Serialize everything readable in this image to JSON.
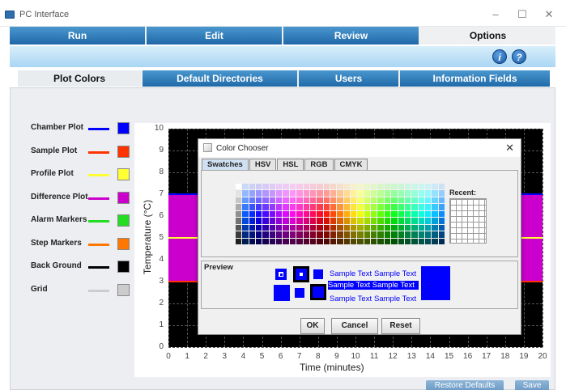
{
  "window": {
    "title": "PC Interface",
    "minimize": "–",
    "maximize": "☐",
    "close": "✕"
  },
  "main_tabs": [
    "Run",
    "Edit",
    "Review",
    "Options"
  ],
  "sub_tabs": [
    "Plot Colors",
    "Default Directories",
    "Users",
    "Information Fields"
  ],
  "legend": [
    {
      "label": "Chamber Plot",
      "color": "#0000ff"
    },
    {
      "label": "Sample Plot",
      "color": "#ff3300"
    },
    {
      "label": "Profile Plot",
      "color": "#ffff33"
    },
    {
      "label": "Difference Plot",
      "color": "#cc00cc"
    },
    {
      "label": "Alarm Markers",
      "color": "#22dd22"
    },
    {
      "label": "Step Markers",
      "color": "#ff7700"
    },
    {
      "label": "Back Ground",
      "color": "#000000"
    },
    {
      "label": "Grid",
      "color": "#cccccc"
    }
  ],
  "chart_data": {
    "type": "line",
    "xlabel": "Time (minutes)",
    "ylabel": "Temperature (°C)",
    "xlim": [
      0,
      20
    ],
    "ylim": [
      0,
      10
    ],
    "x_ticks": [
      "0",
      "1",
      "2",
      "3",
      "4",
      "5",
      "6",
      "7",
      "8",
      "9",
      "10",
      "11",
      "12",
      "13",
      "14",
      "15",
      "16",
      "17",
      "18",
      "19",
      "20"
    ],
    "y_ticks": [
      "0",
      "1",
      "2",
      "3",
      "4",
      "5",
      "6",
      "7",
      "8",
      "9",
      "10"
    ],
    "series": [
      {
        "color": "#0000ff",
        "x": [
          0,
          20
        ],
        "y": [
          7,
          7
        ]
      },
      {
        "color": "#ffff33",
        "x": [
          0,
          20
        ],
        "y": [
          5,
          5
        ]
      },
      {
        "color": "#ff3300",
        "x": [
          0,
          20
        ],
        "y": [
          3,
          3
        ]
      }
    ],
    "difference_band": {
      "color": "#cc00cc",
      "y_range": [
        3,
        7
      ]
    },
    "background": "#000000",
    "grid": true
  },
  "dialog": {
    "title": "Color Chooser",
    "close": "✕",
    "tabs": [
      "Swatches",
      "HSV",
      "HSL",
      "RGB",
      "CMYK"
    ],
    "recent_label": "Recent:",
    "preview_label": "Preview",
    "sample_text": "Sample Text",
    "selected_color": "#0000ff",
    "buttons": {
      "ok": "OK",
      "cancel": "Cancel",
      "reset": "Reset"
    }
  },
  "footer": {
    "restore": "Restore Defaults",
    "save": "Save"
  }
}
